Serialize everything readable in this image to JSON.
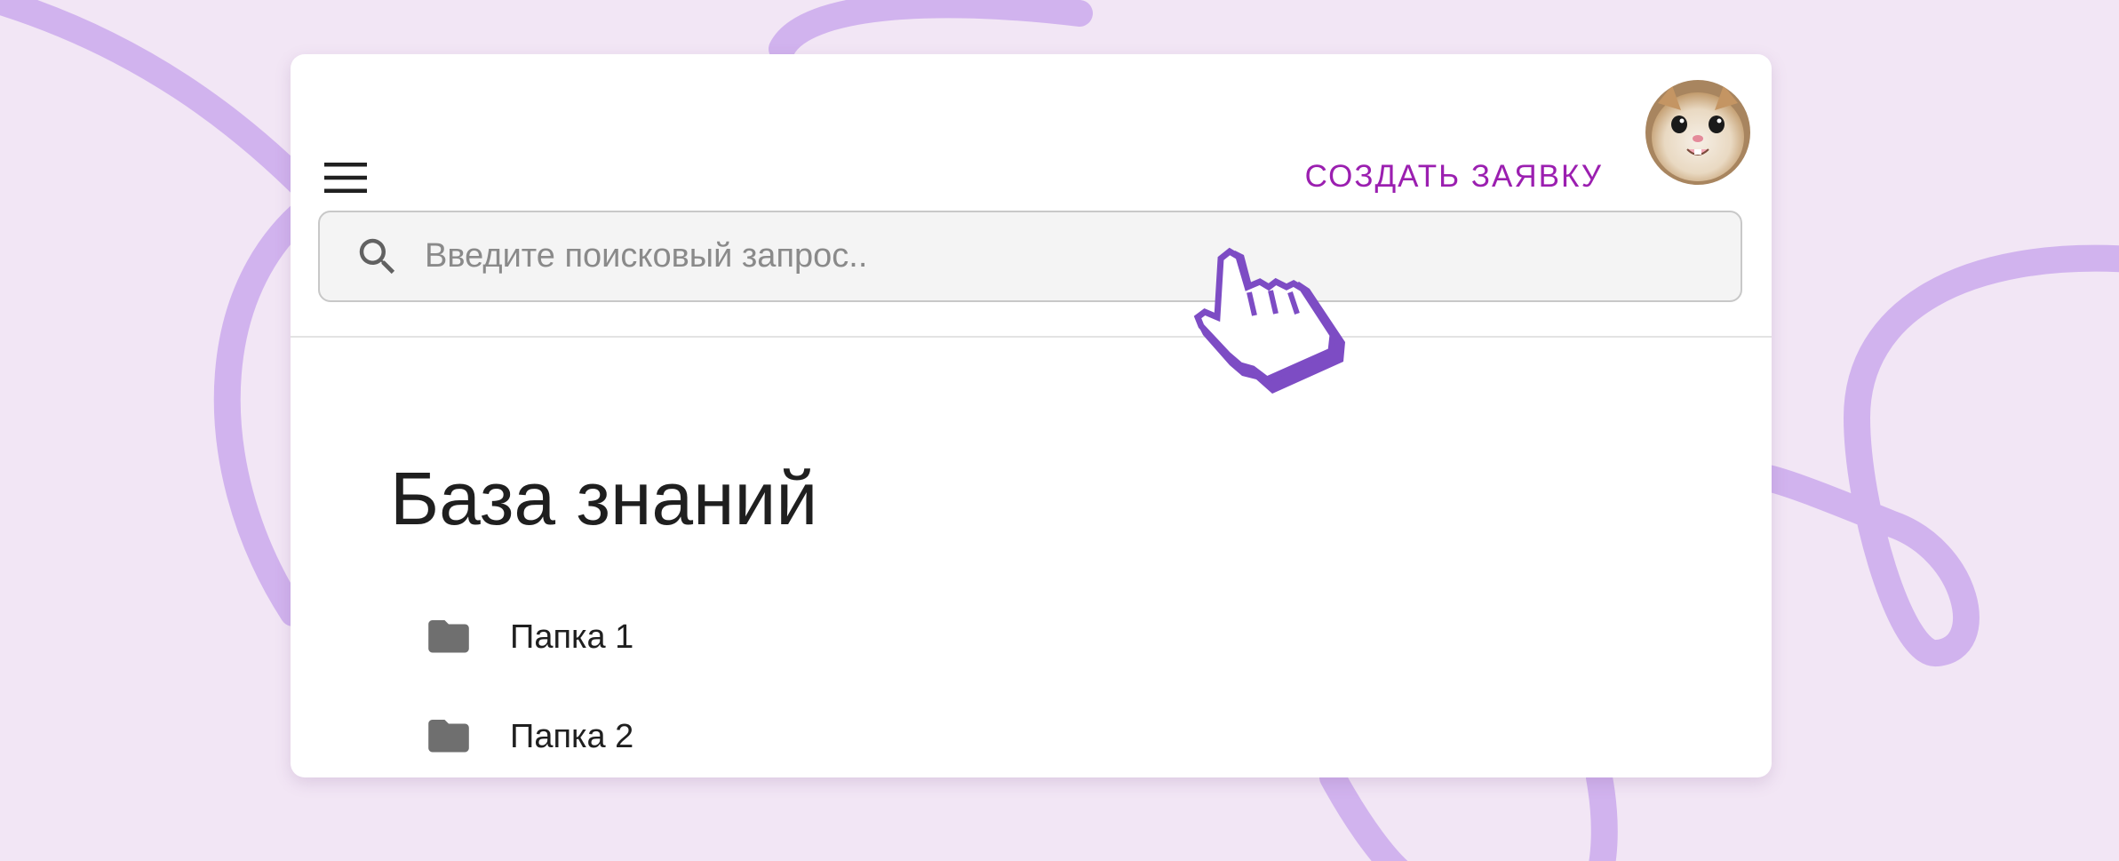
{
  "header": {
    "menu_icon": "hamburger-menu-icon",
    "create_request_label": "СОЗДАТЬ ЗАЯВКУ",
    "avatar_icon": "cat-avatar"
  },
  "search": {
    "icon": "search-icon",
    "placeholder": "Введите поисковый запрос..",
    "value": ""
  },
  "main": {
    "title": "База знаний",
    "folders": [
      {
        "icon": "folder-icon",
        "label": "Папка 1"
      },
      {
        "icon": "folder-icon",
        "label": "Папка 2"
      }
    ]
  },
  "colors": {
    "background": "#f2e6f5",
    "accent": "#9b1fb0",
    "curve": "#d1b3ee",
    "cursor": "#7d4cc4"
  }
}
